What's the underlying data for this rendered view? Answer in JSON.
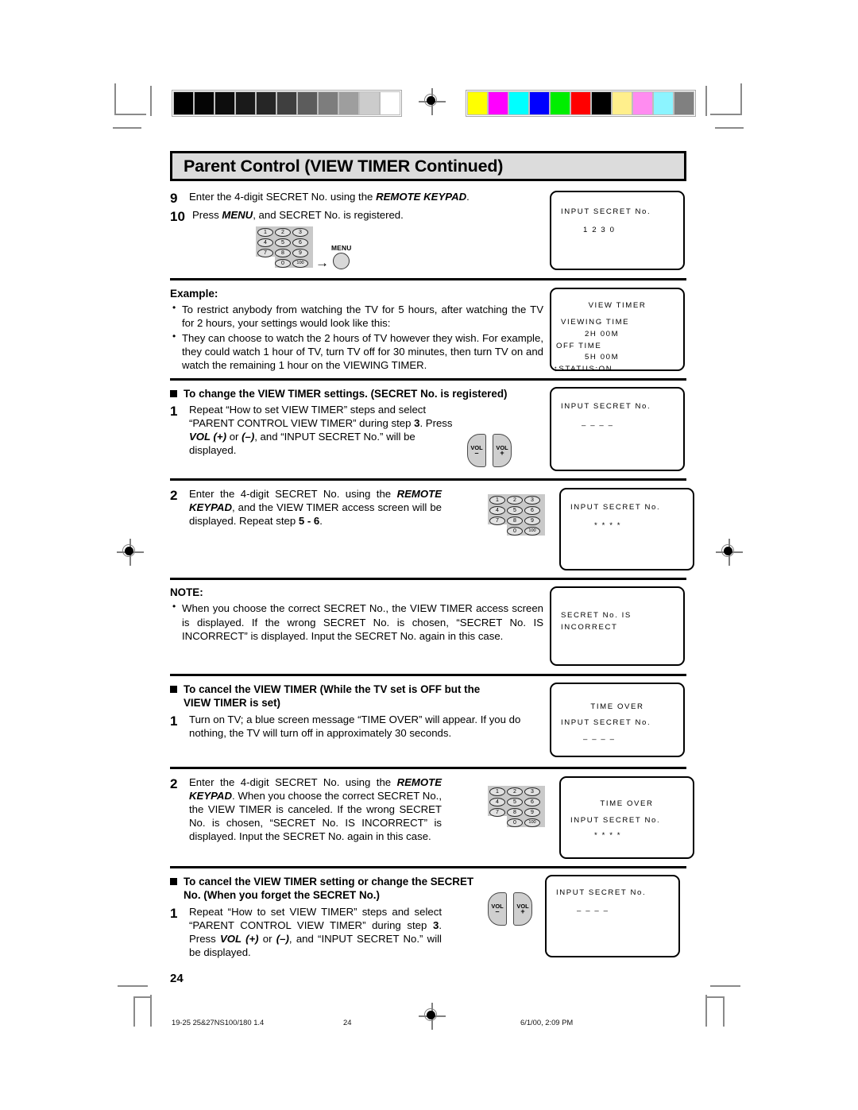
{
  "document": {
    "title": "Parent Control (VIEW TIMER Continued)",
    "page_number": "24"
  },
  "calibration": {
    "gray_ramp": [
      "#000000",
      "#050505",
      "#0d0d0d",
      "#1a1a1a",
      "#262626",
      "#3f3f3f",
      "#5c5c5c",
      "#7d7d7d",
      "#9e9e9e",
      "#cccccc",
      "#ffffff"
    ],
    "color_bar": [
      "#ffff00",
      "#ff00ff",
      "#00ffff",
      "#0000ff",
      "#00ee00",
      "#ff0000",
      "#000000",
      "#ffef8c",
      "#ff8cf0",
      "#8cf4ff",
      "#808080"
    ]
  },
  "steps_9_10": {
    "step9_num": "9",
    "step9_text_a": "Enter the 4-digit SECRET No. using the ",
    "step9_text_b": "REMOTE KEYPAD",
    "step9_text_c": ".",
    "step10_num": "10",
    "step10_text_a": "Press ",
    "step10_text_b": "MENU",
    "step10_text_c": ", and SECRET No. is registered.",
    "menu_button_label": "MENU",
    "arrow": "→",
    "screen": {
      "line1": "INPUT SECRET No.",
      "line2": "1 2 3 0"
    }
  },
  "example": {
    "heading": "Example:",
    "bullets": [
      "To restrict anybody from watching the TV for 5 hours, after watching the TV for 2 hours, your settings would look like this:",
      "They can choose to watch the 2 hours of TV however they wish. For example, they could watch 1 hour of TV, turn TV off for 30 minutes, then turn TV on and watch the remaining 1 hour on the VIEWING TIMER."
    ],
    "screen": {
      "line1": "VIEW TIMER",
      "line2": "VIEWING TIME",
      "line3": "2H 00M",
      "line4": "OFF TIME",
      "line5": "5H 00M",
      "line6": "↕STATUS:ON"
    }
  },
  "change_settings": {
    "heading": "To change the VIEW TIMER settings. (SECRET No. is registered)",
    "step1_num": "1",
    "step1_a": "Repeat “How to set VIEW TIMER” steps and select “PARENT CONTROL VIEW TIMER” during step ",
    "step1_b": "3",
    "step1_c": ". Press ",
    "step1_d": "VOL (+)",
    "step1_e": " or ",
    "step1_f": "(–)",
    "step1_g": ", and “INPUT SECRET No.” will be displayed.",
    "vol_minus_label": "VOL",
    "vol_minus_sign": "–",
    "vol_plus_label": "VOL",
    "vol_plus_sign": "+",
    "screen": {
      "line1": "INPUT SECRET No.",
      "line2": "–  –  –  –"
    }
  },
  "step2_change": {
    "num": "2",
    "text_a": "Enter the 4-digit SECRET No. using the ",
    "text_b": "REMOTE KEYPAD",
    "text_c": ", and the VIEW TIMER access screen will be displayed. Repeat step ",
    "text_d": "5 - 6",
    "text_e": ".",
    "screen": {
      "line1": "INPUT SECRET No.",
      "line2": "*  *  *  *"
    }
  },
  "note": {
    "label": "NOTE:",
    "bullets": [
      "When you choose the correct SECRET No., the VIEW TIMER access screen is displayed. If the wrong SECRET No. is chosen, “SECRET No. IS INCORRECT” is displayed. Input the SECRET No. again in this case."
    ],
    "screen": {
      "line1": "SECRET No. IS",
      "line2": "INCORRECT"
    }
  },
  "cancel_timer": {
    "heading_line1": "To cancel the VIEW TIMER (While the TV set is OFF but the",
    "heading_line2": "VIEW TIMER is set)",
    "step1_num": "1",
    "step1_text": "Turn on TV; a blue screen message “TIME OVER” will appear. If you do nothing, the TV will turn off in approximately 30 seconds.",
    "screen": {
      "line1": "TIME OVER",
      "line2": "INPUT SECRET No.",
      "line3": "–  –  –  –"
    }
  },
  "step2_cancel": {
    "num": "2",
    "text_a": "Enter the 4-digit SECRET No. using the ",
    "text_b": "REMOTE KEYPAD",
    "text_c": ". When you choose the correct SECRET No., the VIEW TIMER is canceled. If the wrong SECRET No. is chosen, “SECRET No. IS INCORRECT” is displayed. Input the SECRET No. again in this case.",
    "screen": {
      "line1": "TIME OVER",
      "line2": "INPUT SECRET No.",
      "line3": "*  *  *  *"
    }
  },
  "cancel_or_change": {
    "heading_line1": "To cancel the VIEW TIMER setting or change the SECRET",
    "heading_line2": "No. (When you forget the SECRET No.)",
    "step1_num": "1",
    "step1_a": "Repeat “How to set VIEW TIMER” steps and select “PARENT CONTROL VIEW TIMER” during step ",
    "step1_b": "3",
    "step1_c": ". Press ",
    "step1_d": "VOL (+)",
    "step1_e": " or ",
    "step1_f": "(–)",
    "step1_g": ", and “INPUT SECRET No.” will be displayed.",
    "vol_minus_label": "VOL",
    "vol_minus_sign": "–",
    "vol_plus_label": "VOL",
    "vol_plus_sign": "+",
    "screen": {
      "line1": "INPUT SECRET No.",
      "line2": "–  –  –  –"
    }
  },
  "keypad": {
    "keys": [
      "1",
      "2",
      "3",
      "4",
      "5",
      "6",
      "7",
      "8",
      "9",
      "0",
      "100"
    ]
  },
  "footer": {
    "left": "19-25 25&27NS100/180 1.4",
    "center": "24",
    "right": "6/1/00, 2:09 PM"
  }
}
